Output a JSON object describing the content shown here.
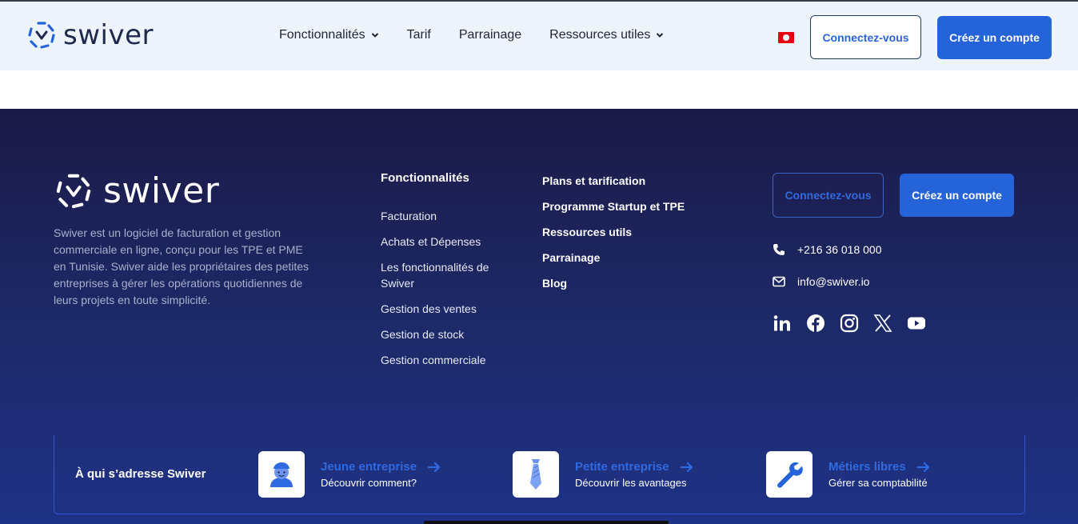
{
  "header": {
    "brand": "swiver",
    "nav": [
      {
        "label": "Fonctionnalités",
        "has_dropdown": true
      },
      {
        "label": "Tarif",
        "has_dropdown": false
      },
      {
        "label": "Parrainage",
        "has_dropdown": false
      },
      {
        "label": "Ressources utiles",
        "has_dropdown": true
      }
    ],
    "flag_icon": "tunisia-flag-icon",
    "login_label": "Connectez-vous",
    "signup_label": "Créez un compte"
  },
  "footer": {
    "brand": "swiver",
    "about": "Swiver est un logiciel de facturation et gestion commerciale en ligne, conçu pour les TPE et PME en Tunisie. Swiver aide les propriétaires des petites entreprises à gérer les opérations quotidiennes de leurs projets  en toute simplicité.",
    "features_title": "Fonctionnalités",
    "features_links": [
      "Facturation",
      "Achats et Dépenses",
      "Les fonctionnalités de Swiver",
      "Gestion des ventes",
      "Gestion de stock",
      "Gestion commerciale"
    ],
    "links": [
      "Plans et tarification",
      "Programme Startup et TPE",
      "Ressources utils",
      "Parrainage",
      "Blog"
    ],
    "login_label": "Connectez-vous",
    "signup_label": "Créez un compte",
    "phone": "+216 36 018 000",
    "email": "info@swiver.io",
    "social_icons": [
      "linkedin-icon",
      "facebook-icon",
      "instagram-icon",
      "x-icon",
      "youtube-icon"
    ]
  },
  "audience": {
    "title": "À qui s’adresse Swiver",
    "cards": [
      {
        "name": "Jeune entreprise",
        "sub": "Découvrir comment?",
        "icon": "young-person-icon"
      },
      {
        "name": "Petite entreprise",
        "sub": "Découvrir les avantages",
        "icon": "tie-icon"
      },
      {
        "name": "Métiers libres",
        "sub": "Gérer sa comptabilité",
        "icon": "wrench-icon"
      }
    ]
  },
  "colors": {
    "accent": "#2563d8",
    "link_blue": "#2f6ae0",
    "footer_bg_top": "#1b1a46",
    "footer_bg_bottom": "#1e3286",
    "header_bg": "#eef4fb"
  }
}
